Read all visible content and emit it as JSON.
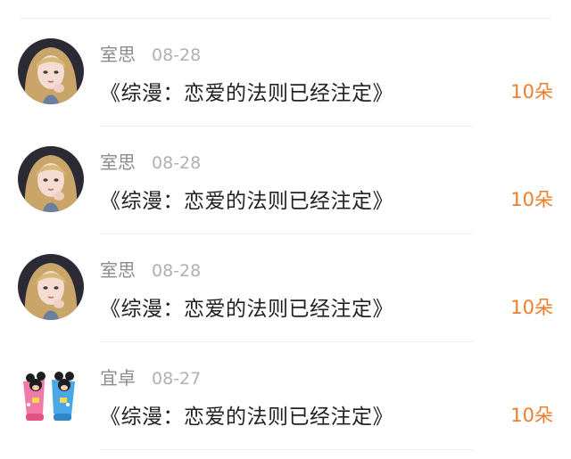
{
  "accent_color": "#f07d2a",
  "rows": [
    {
      "avatar_icon": "girl-portrait-avatar",
      "name": "室思",
      "date": "08-28",
      "title": "《综漫：恋爱的法则已经注定》",
      "amount": "10朵"
    },
    {
      "avatar_icon": "girl-portrait-avatar",
      "name": "室思",
      "date": "08-28",
      "title": "《综漫：恋爱的法则已经注定》",
      "amount": "10朵"
    },
    {
      "avatar_icon": "girl-portrait-avatar",
      "name": "室思",
      "date": "08-28",
      "title": "《综漫：恋爱的法则已经注定》",
      "amount": "10朵"
    },
    {
      "avatar_icon": "cartoon-cups-avatar",
      "name": "宜卓",
      "date": "08-27",
      "title": "《综漫：恋爱的法则已经注定》",
      "amount": "10朵"
    }
  ]
}
